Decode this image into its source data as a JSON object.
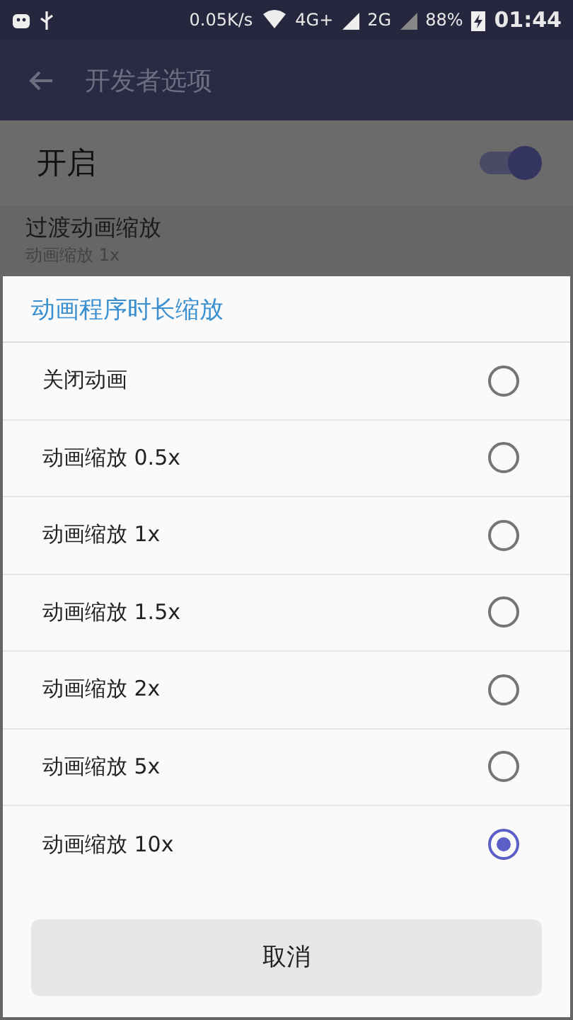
{
  "status_bar": {
    "speed": "0.05K/s",
    "network_1": "4G+",
    "network_2": "2G",
    "battery": "88%",
    "time": "01:44"
  },
  "app_bar": {
    "title": "开发者选项"
  },
  "master_switch": {
    "label": "开启",
    "on": true
  },
  "setting": {
    "title": "过渡动画缩放",
    "subtitle": "动画缩放 1x"
  },
  "dialog": {
    "title": "动画程序时长缩放",
    "options": [
      {
        "label": "关闭动画",
        "selected": false
      },
      {
        "label": "动画缩放 0.5x",
        "selected": false
      },
      {
        "label": "动画缩放 1x",
        "selected": false
      },
      {
        "label": "动画缩放 1.5x",
        "selected": false
      },
      {
        "label": "动画缩放 2x",
        "selected": false
      },
      {
        "label": "动画缩放 5x",
        "selected": false
      },
      {
        "label": "动画缩放 10x",
        "selected": true
      }
    ],
    "cancel": "取消"
  }
}
